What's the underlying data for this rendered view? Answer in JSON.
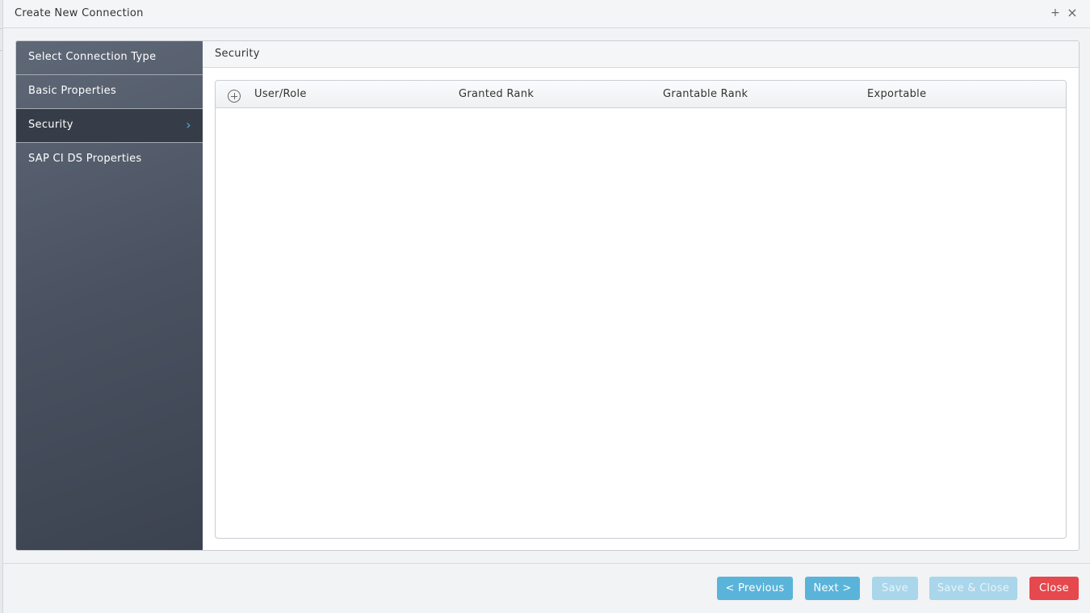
{
  "window": {
    "title": "Create New Connection",
    "maximize_glyph": "+",
    "close_glyph": "×"
  },
  "sidebar": {
    "items": [
      {
        "label": "Select Connection Type"
      },
      {
        "label": "Basic Properties"
      },
      {
        "label": "Security",
        "active": true
      },
      {
        "label": "SAP CI DS Properties"
      }
    ],
    "chevron_glyph": "›"
  },
  "content": {
    "header": "Security",
    "table": {
      "columns": [
        "User/Role",
        "Granted Rank",
        "Grantable Rank",
        "Exportable"
      ],
      "rows": []
    }
  },
  "footer": {
    "previous_label": "< Previous",
    "next_label": "Next >",
    "save_label": "Save",
    "save_close_label": "Save & Close",
    "close_label": "Close"
  },
  "colors": {
    "primary_button": "#5ab4da",
    "disabled_button": "#a9d6ea",
    "danger_button": "#e5484d",
    "sidebar_active": "#373d48",
    "chevron": "#5aa8d8"
  },
  "icons": {
    "add": "add-circle-icon",
    "chevron": "chevron-right-icon",
    "maximize": "plus-icon",
    "close": "close-icon"
  }
}
